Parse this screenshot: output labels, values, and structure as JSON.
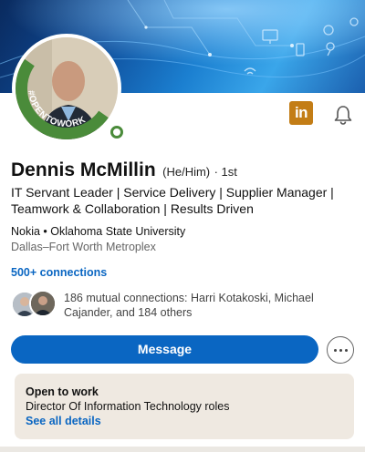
{
  "colors": {
    "accent": "#0a66c2",
    "open_to_work_green": "#4a8b3a",
    "linkedin_badge": "#c37d16",
    "card_bg": "#efe9e1"
  },
  "profile": {
    "badge_text": "#OPENTOWORK",
    "name": "Dennis McMillin",
    "pronouns": "(He/Him)",
    "degree": "· 1st",
    "headline": "IT Servant Leader | Service Delivery | Supplier Manager | Teamwork & Collaboration | Results Driven",
    "org": "Nokia • Oklahoma State University",
    "location": "Dallas–Fort Worth Metroplex",
    "connections": "500+ connections"
  },
  "mutual": {
    "text": "186 mutual connections: Harri Kotakoski, Michael Cajander, and 184 others"
  },
  "actions": {
    "linkedin_icon": "in",
    "message_label": "Message",
    "more_icon": "more-icon",
    "bell_icon": "bell-icon"
  },
  "open_to_work_card": {
    "title": "Open to work",
    "roles": "Director Of Information Technology roles",
    "link": "See all details"
  }
}
